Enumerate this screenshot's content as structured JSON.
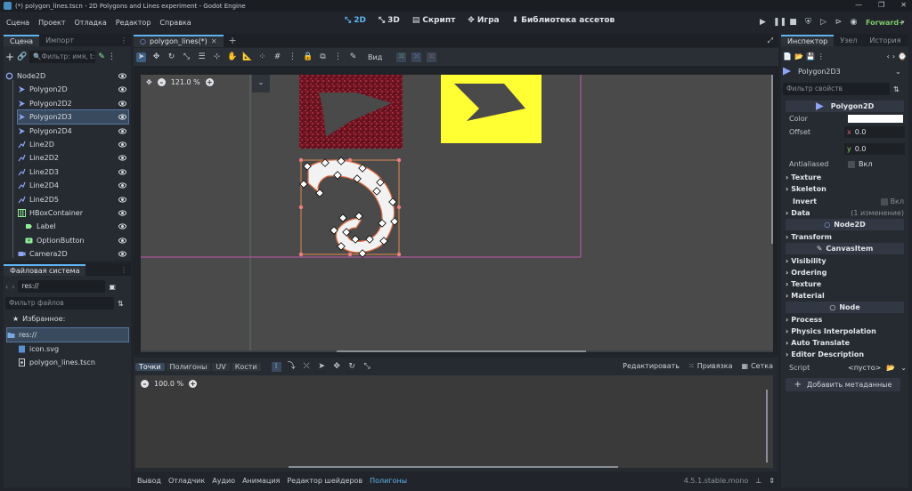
{
  "window": {
    "title": "(*) polygon_lines.tscn - 2D Polygons and Lines experiment - Godot Engine"
  },
  "menu": [
    "Сцена",
    "Проект",
    "Отладка",
    "Редактор",
    "Справка"
  ],
  "workspaces": [
    {
      "label": "2D",
      "icon": "2d-icon",
      "active": true
    },
    {
      "label": "3D",
      "icon": "3d-icon",
      "active": false
    },
    {
      "label": "Скрипт",
      "icon": "script-icon",
      "active": false
    },
    {
      "label": "Игра",
      "icon": "game-icon",
      "active": false
    },
    {
      "label": "Библиотека ассетов",
      "icon": "asset-library-icon",
      "active": false
    }
  ],
  "renderer": "Forward+",
  "scene_panel": {
    "tabs": [
      "Сцена",
      "Импорт"
    ],
    "filter_placeholder": "Фильтр: имя, t:",
    "nodes": [
      {
        "label": "Node2D",
        "icon": "node2d-icon",
        "indent": 0,
        "color": "#8da5f3"
      },
      {
        "label": "Polygon2D",
        "icon": "polygon2d-icon",
        "indent": 1,
        "color": "#8da5f3"
      },
      {
        "label": "Polygon2D2",
        "icon": "polygon2d-icon",
        "indent": 1,
        "color": "#8da5f3"
      },
      {
        "label": "Polygon2D3",
        "icon": "polygon2d-icon",
        "indent": 1,
        "color": "#8da5f3",
        "selected": true
      },
      {
        "label": "Polygon2D4",
        "icon": "polygon2d-icon",
        "indent": 1,
        "color": "#8da5f3"
      },
      {
        "label": "Line2D",
        "icon": "line2d-icon",
        "indent": 1,
        "color": "#8da5f3"
      },
      {
        "label": "Line2D2",
        "icon": "line2d-icon",
        "indent": 1,
        "color": "#8da5f3"
      },
      {
        "label": "Line2D3",
        "icon": "line2d-icon",
        "indent": 1,
        "color": "#8da5f3"
      },
      {
        "label": "Line2D4",
        "icon": "line2d-icon",
        "indent": 1,
        "color": "#8da5f3"
      },
      {
        "label": "Line2D5",
        "icon": "line2d-icon",
        "indent": 1,
        "color": "#8da5f3"
      },
      {
        "label": "HBoxContainer",
        "icon": "hbox-icon",
        "indent": 1,
        "color": "#8eef97"
      },
      {
        "label": "Label",
        "icon": "label-icon",
        "indent": 2,
        "color": "#8eef97"
      },
      {
        "label": "OptionButton",
        "icon": "option-button-icon",
        "indent": 2,
        "color": "#8eef97"
      },
      {
        "label": "Camera2D",
        "icon": "camera2d-icon",
        "indent": 1,
        "color": "#8da5f3"
      }
    ]
  },
  "filesystem": {
    "title": "Файловая система",
    "path": "res://",
    "filter_placeholder": "Фильтр файлов",
    "favorites": "Избранное:",
    "items": [
      {
        "label": "res://",
        "icon": "folder-icon",
        "indent": 0,
        "selected": true
      },
      {
        "label": "icon.svg",
        "icon": "svg-file-icon",
        "indent": 1
      },
      {
        "label": "polygon_lines.tscn",
        "icon": "scene-file-icon",
        "indent": 1
      }
    ]
  },
  "editor_tabs": [
    "polygon_lines(*)"
  ],
  "viewport": {
    "zoom": "121.0 %",
    "view_menu": "Вид"
  },
  "polygon_editor": {
    "tabs": [
      "Точки",
      "Полигоны",
      "UV",
      "Кости"
    ],
    "edit_label": "Редактировать",
    "snap_label": "Привязка",
    "grid_label": "Сетка",
    "zoom": "100.0 %"
  },
  "bottom_panel": {
    "tabs": [
      "Вывод",
      "Отладчик",
      "Аудио",
      "Анимация",
      "Редактор шейдеров",
      "Полигоны"
    ],
    "active": "Полигоны",
    "version": "4.5.1.stable.mono"
  },
  "inspector": {
    "tabs": [
      "Инспектор",
      "Узел",
      "История"
    ],
    "object_name": "Polygon2D3",
    "filter_placeholder": "Фильтр свойств",
    "section_polygon2d": "Polygon2D",
    "color_label": "Color",
    "color_value": "#ffffff",
    "offset_label": "Offset",
    "offset_x_label": "x",
    "offset_x": "0.0",
    "offset_y_label": "y",
    "offset_y": "0.0",
    "antialiased_label": "Antialiased",
    "antialiased_value": "Вкл",
    "texture_label": "Texture",
    "skeleton_label": "Skeleton",
    "invert_label": "Invert",
    "invert_value": "Вкл",
    "data_label": "Data",
    "data_changes": "(1 изменение)",
    "section_node2d": "Node2D",
    "transform_label": "Transform",
    "section_canvasitem": "CanvasItem",
    "visibility_label": "Visibility",
    "ordering_label": "Ordering",
    "ci_texture_label": "Texture",
    "material_label": "Material",
    "section_node": "Node",
    "process_label": "Process",
    "physics_interp_label": "Physics Interpolation",
    "auto_translate_label": "Auto Translate",
    "editor_description_label": "Editor Description",
    "script_label": "Script",
    "script_value": "<пусто>",
    "add_metadata": "Добавить метаданные"
  },
  "colors": {
    "accent": "#5fb4f0",
    "selection": "#3a4a5e",
    "canvas_bg": "#4a4a4a",
    "yellow_box": "#ffff33",
    "dark_red": "#7a1a24"
  }
}
